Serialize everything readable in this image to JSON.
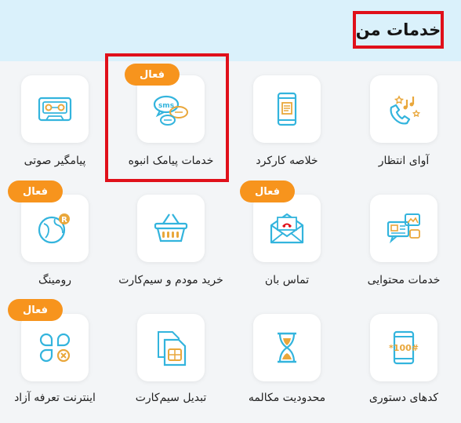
{
  "page": {
    "title": "خدمات من"
  },
  "badge_label": "فعال",
  "services": [
    {
      "label": "آوای انتظار",
      "icon": "phone-music-icon",
      "active": false
    },
    {
      "label": "خلاصه کارکرد",
      "icon": "mobile-report-icon",
      "active": false
    },
    {
      "label": "خدمات پیامک انبوه",
      "icon": "sms-bubbles-icon",
      "active": true
    },
    {
      "label": "پیامگیر صوتی",
      "icon": "cassette-icon",
      "active": false
    },
    {
      "label": "خدمات محتوایی",
      "icon": "content-chat-icon",
      "active": false
    },
    {
      "label": "تماس بان",
      "icon": "envelope-phone-icon",
      "active": true
    },
    {
      "label": "خرید مودم و سیم‌کارت",
      "icon": "shopping-basket-icon",
      "active": false
    },
    {
      "label": "رومینگ",
      "icon": "globe-roaming-icon",
      "active": true
    },
    {
      "label": "کدهای دستوری",
      "icon": "ussd-phone-icon",
      "active": false
    },
    {
      "label": "محدودیت مکالمه",
      "icon": "hourglass-icon",
      "active": false
    },
    {
      "label": "تبدیل سیم‌کارت",
      "icon": "sim-card-icon",
      "active": false
    },
    {
      "label": "اینترنت تعرفه آزاد",
      "icon": "internet-tariff-icon",
      "active": true
    }
  ],
  "colors": {
    "accent": "#33b4dd",
    "badge": "#f7941d",
    "highlight": "#e0101a",
    "header_bg": "#daf1fb",
    "music_note": "#e9a73b"
  }
}
